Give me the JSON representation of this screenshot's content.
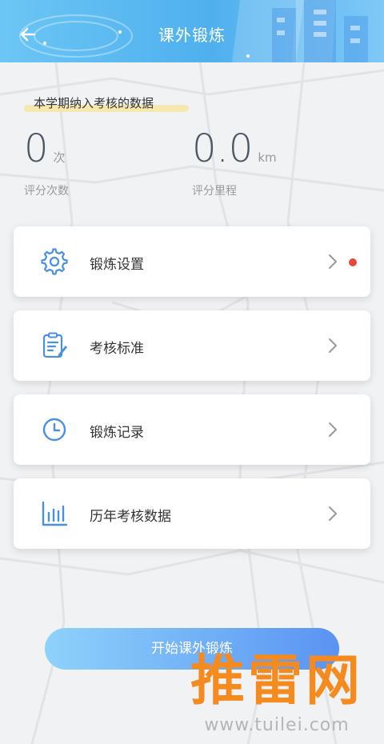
{
  "header": {
    "title": "课外锻炼"
  },
  "stats": {
    "semester_label": "本学期纳入考核的数据",
    "count": {
      "value": "0",
      "unit": "次",
      "caption": "评分次数"
    },
    "distance": {
      "value": "0.0",
      "unit": "km",
      "caption": "评分里程"
    }
  },
  "menu": {
    "items": [
      {
        "label": "锻炼设置",
        "icon": "gear-icon",
        "has_badge": true
      },
      {
        "label": "考核标准",
        "icon": "document-edit-icon",
        "has_badge": false
      },
      {
        "label": "锻炼记录",
        "icon": "clock-icon",
        "has_badge": false
      },
      {
        "label": "历年考核数据",
        "icon": "bar-chart-icon",
        "has_badge": false
      }
    ]
  },
  "start_button": {
    "label": "开始课外锻炼"
  },
  "watermark": {
    "text": "推雷网",
    "url": "www.tuilei.com"
  },
  "colors": {
    "accent": "#4a90e2",
    "header_start": "#6cc6f5",
    "header_end": "#4fb0ee",
    "badge": "#e5483d",
    "highlight": "#f6e5a6",
    "watermark": "#f58a1f"
  }
}
